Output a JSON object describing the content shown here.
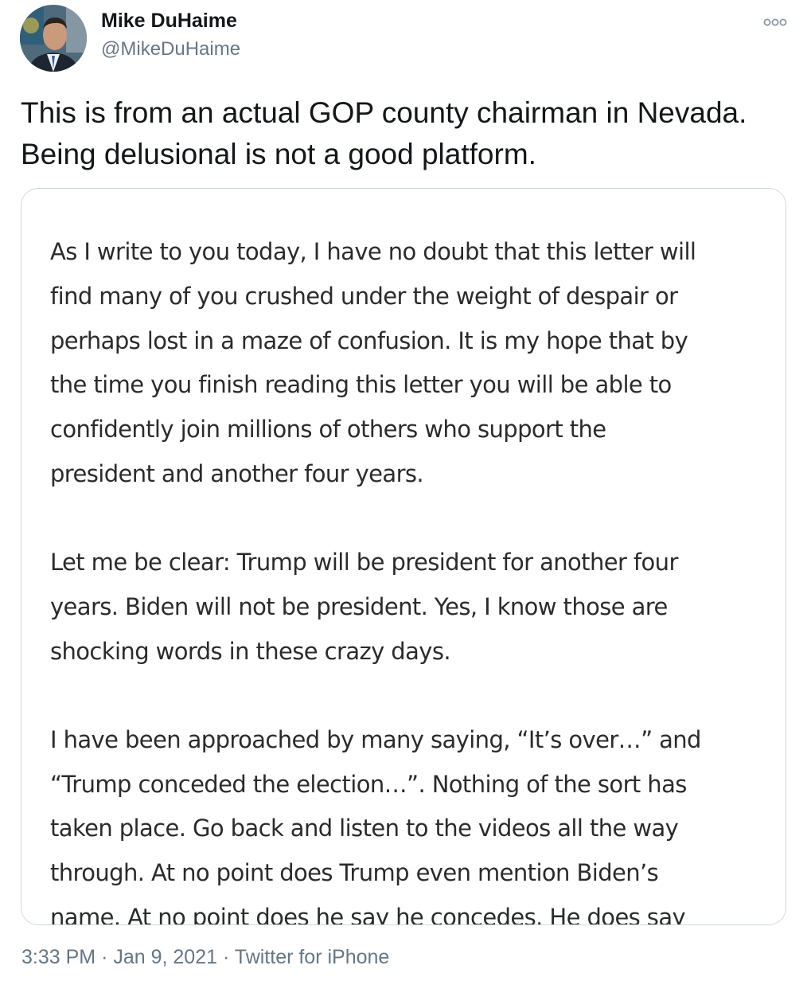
{
  "author": {
    "name": "Mike DuHaime",
    "handle": "@MikeDuHaime"
  },
  "tweet_text_lines": [
    "This is from an actual GOP county chairman in Nevada.",
    "Being delusional is not a good platform."
  ],
  "letter": {
    "paragraphs": [
      {
        "lines": [
          "As I write to you today, I have no doubt that this letter will",
          "find many of you crushed under the weight of despair or",
          "perhaps lost in a maze of confusion. It is my hope that by",
          "the time you finish reading this letter you will be able to",
          "confidently join millions of others who support the",
          "president and another four years."
        ]
      },
      {
        "lines": [
          "Let me be clear: Trump will be president for another four",
          "years. Biden will not be president. Yes, I know those are",
          "shocking words in these crazy days."
        ]
      },
      {
        "lines": [
          "I have been approached by many saying, “It’s over…” and",
          "“Trump conceded the election…”. Nothing of the sort has",
          "taken place. Go back and listen to the videos all the way",
          "through. At no point does Trump even mention Biden’s",
          "name. At no point does he say he concedes. He does say"
        ]
      }
    ]
  },
  "meta": {
    "time": "3:33 PM",
    "separator": "·",
    "date": "Jan 9, 2021",
    "source": "Twitter for iPhone"
  },
  "icons": {
    "more": "more-options-icon",
    "avatar": "profile-photo"
  }
}
